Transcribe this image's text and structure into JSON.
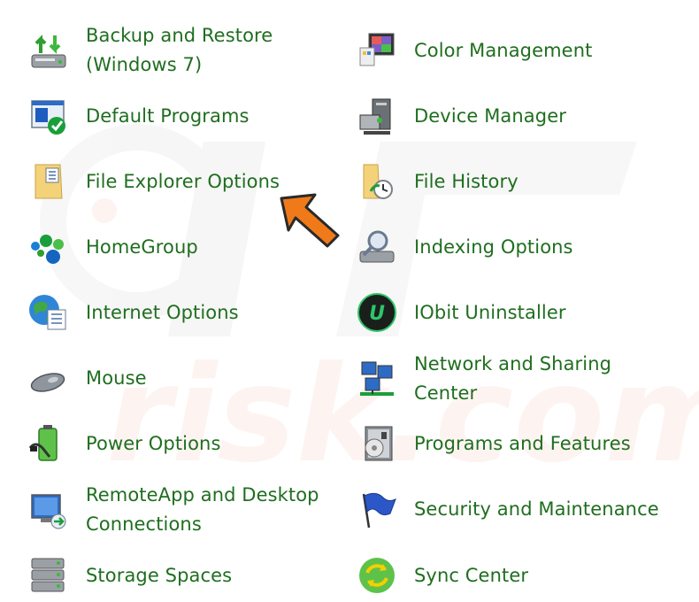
{
  "control_panel": {
    "left_items": [
      {
        "label": "Backup and Restore\n(Windows 7)",
        "icon": "backup-restore-icon"
      },
      {
        "label": "Default Programs",
        "icon": "default-programs-icon"
      },
      {
        "label": "File Explorer Options",
        "icon": "file-explorer-options-icon"
      },
      {
        "label": "HomeGroup",
        "icon": "homegroup-icon"
      },
      {
        "label": "Internet Options",
        "icon": "internet-options-icon"
      },
      {
        "label": "Mouse",
        "icon": "mouse-icon"
      },
      {
        "label": "Power Options",
        "icon": "power-options-icon"
      },
      {
        "label": "RemoteApp and Desktop\nConnections",
        "icon": "remoteapp-icon"
      },
      {
        "label": "Storage Spaces",
        "icon": "storage-spaces-icon"
      }
    ],
    "right_items": [
      {
        "label": "Color Management",
        "icon": "color-management-icon"
      },
      {
        "label": "Device Manager",
        "icon": "device-manager-icon"
      },
      {
        "label": "File History",
        "icon": "file-history-icon"
      },
      {
        "label": "Indexing Options",
        "icon": "indexing-options-icon"
      },
      {
        "label": "IObit Uninstaller",
        "icon": "iobit-uninstaller-icon"
      },
      {
        "label": "Network and Sharing\nCenter",
        "icon": "network-sharing-icon"
      },
      {
        "label": "Programs and Features",
        "icon": "programs-features-icon"
      },
      {
        "label": "Security and Maintenance",
        "icon": "security-maintenance-icon"
      },
      {
        "label": "Sync Center",
        "icon": "sync-center-icon"
      }
    ]
  },
  "annotation": {
    "icon": "orange-arrow-icon",
    "color": "#f07a1a"
  },
  "watermark": {
    "text": "PC risk.com",
    "icon": "pcrisk-watermark-logo"
  },
  "colors": {
    "link_text": "#1f6e1f",
    "background": "#ffffff"
  }
}
